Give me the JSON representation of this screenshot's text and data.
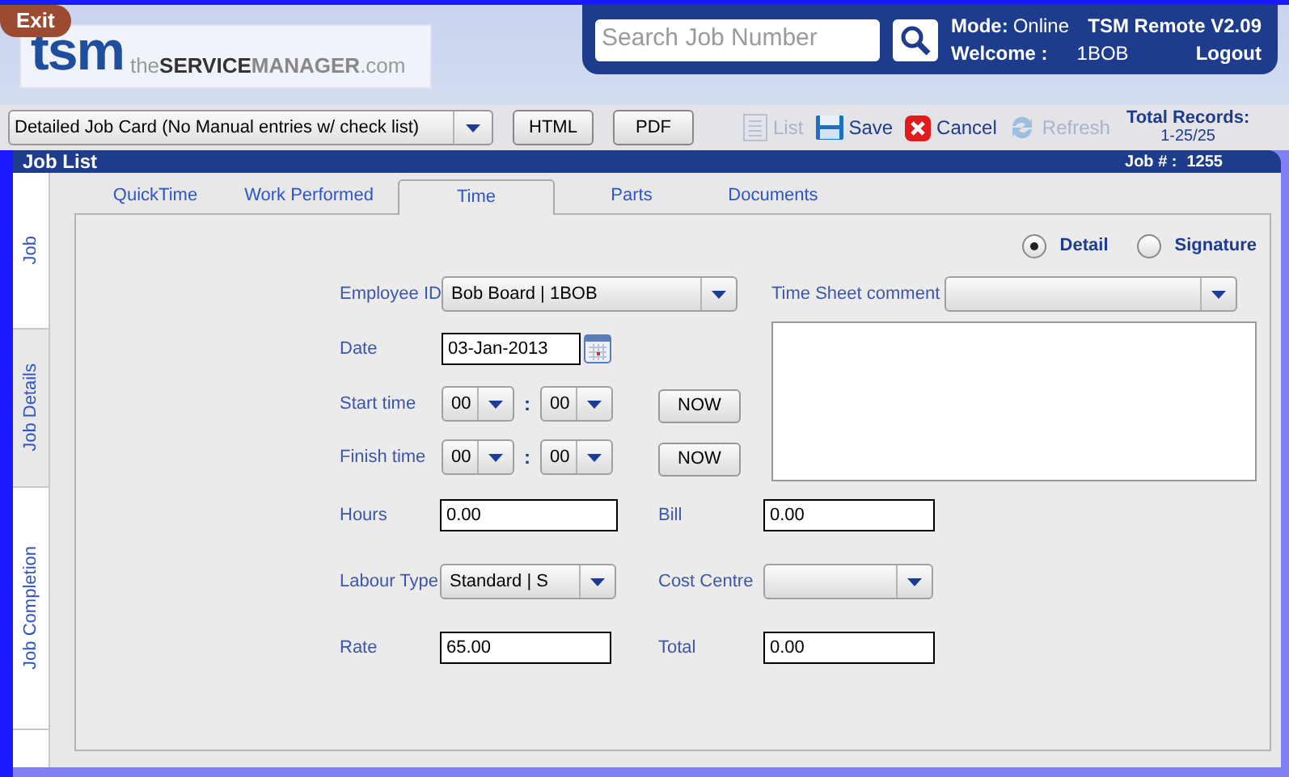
{
  "header": {
    "exit": "Exit",
    "logo": {
      "mark": "tsm",
      "parts": [
        {
          "text": "the",
          "kind": "light"
        },
        {
          "text": "SERVICE",
          "kind": "strong"
        },
        {
          "text": "MANAGER",
          "kind": "medium"
        },
        {
          "text": ".com",
          "kind": "light"
        }
      ]
    },
    "search": {
      "placeholder": "Search Job Number"
    },
    "mode_label": "Mode:",
    "mode": "Online",
    "version": "TSM Remote V2.09",
    "welcome_label": "Welcome :",
    "user": "1BOB",
    "logout": "Logout"
  },
  "toolbar": {
    "report": "Detailed Job Card (No Manual entries w/ check list)",
    "buttons": [
      "HTML",
      "PDF"
    ],
    "actions": [
      {
        "kind": "list",
        "label": "List",
        "disabled": true
      },
      {
        "kind": "save",
        "label": "Save",
        "disabled": false
      },
      {
        "kind": "cancel",
        "label": "Cancel",
        "disabled": false
      },
      {
        "kind": "refresh",
        "label": "Refresh",
        "disabled": true
      }
    ],
    "total_label": "Total Records:",
    "total": "1-25/25"
  },
  "panel": {
    "title": "Job List",
    "job_label": "Job # :",
    "job_number": "1255"
  },
  "side_tabs": [
    {
      "label": "Job",
      "selected": false
    },
    {
      "label": "Job Details",
      "selected": true
    },
    {
      "label": "Job Completion",
      "selected": false
    }
  ],
  "tabs": [
    {
      "label": "QuickTime",
      "selected": false
    },
    {
      "label": "Work Performed",
      "selected": false
    },
    {
      "label": "Time",
      "selected": true
    },
    {
      "label": "Parts",
      "selected": false
    },
    {
      "label": "Documents",
      "selected": false
    }
  ],
  "view_options": [
    {
      "label": "Detail",
      "selected": true
    },
    {
      "label": "Signature",
      "selected": false
    }
  ],
  "form": {
    "employee_label": "Employee ID",
    "employee": "Bob Board | 1BOB",
    "date_label": "Date",
    "date": "03-Jan-2013",
    "start_label": "Start time",
    "start_hour": "00",
    "start_minute": "00",
    "finish_label": "Finish time",
    "finish_hour": "00",
    "finish_minute": "00",
    "separator": ":",
    "now": [
      "NOW",
      "NOW"
    ],
    "comment_label": "Time Sheet comment",
    "hours_label": "Hours",
    "hours": "0.00",
    "bill_label": "Bill",
    "bill": "0.00",
    "labour_label": "Labour Type",
    "labour": "Standard | S",
    "cost_label": "Cost Centre",
    "rate_label": "Rate",
    "rate": "65.00",
    "total_label": "Total",
    "total": "0.00"
  }
}
